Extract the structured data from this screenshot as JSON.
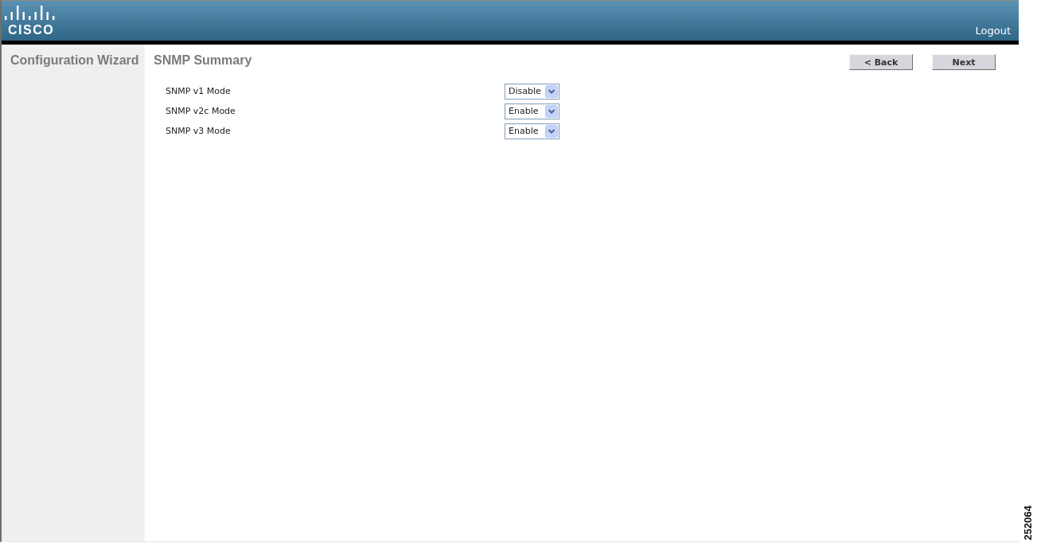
{
  "header": {
    "logo_text": "CISCO",
    "logout": "Logout"
  },
  "sidebar": {
    "title": "Configuration Wizard"
  },
  "page": {
    "title": "SNMP Summary",
    "buttons": [
      "< Back",
      "Next"
    ]
  },
  "settings": [
    {
      "label": "SNMP v1 Mode",
      "value": "Disable"
    },
    {
      "label": "SNMP v2c Mode",
      "value": "Enable"
    },
    {
      "label": "SNMP v3 Mode",
      "value": "Enable"
    }
  ],
  "figure_number": "252064"
}
